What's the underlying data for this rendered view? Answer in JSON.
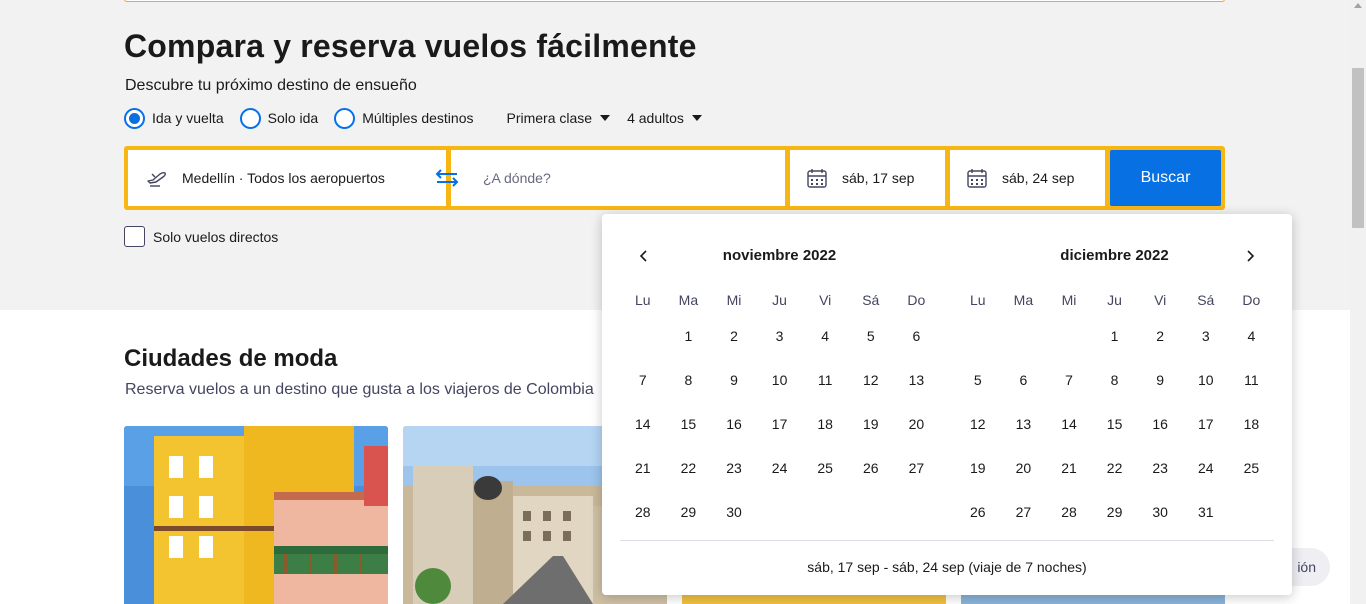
{
  "header": {
    "title": "Compara y reserva vuelos fácilmente",
    "subtitle": "Descubre tu próximo destino de ensueño"
  },
  "trip_options": {
    "round_trip": "Ida y vuelta",
    "one_way": "Solo ida",
    "multi_city": "Múltiples destinos",
    "selected": "Ida y vuelta",
    "cabin_class": "Primera clase",
    "travellers": "4 adultos"
  },
  "search": {
    "origin": "Medellín · Todos los aeropuertos",
    "destination_placeholder": "¿A dónde?",
    "depart_date": "sáb, 17 sep",
    "return_date": "sáb, 24 sep",
    "search_button": "Buscar"
  },
  "direct_only": {
    "label": "Solo vuelos directos",
    "checked": false
  },
  "trending": {
    "title": "Ciudades de moda",
    "subtitle": "Reserva vuelos a un destino que gusta a los viajeros de Colombia"
  },
  "calendar": {
    "weekdays": [
      "Lu",
      "Ma",
      "Mi",
      "Ju",
      "Vi",
      "Sá",
      "Do"
    ],
    "months": [
      {
        "title": "noviembre 2022",
        "leading_blanks": 1,
        "days": 30
      },
      {
        "title": "diciembre 2022",
        "leading_blanks": 3,
        "days": 31
      }
    ],
    "summary": "sáb, 17 sep - sáb, 24 sep (viaje de 7 noches)"
  },
  "feedback": {
    "label": "ión"
  },
  "colors": {
    "accent_blue": "#0770e3",
    "search_border": "#f8b614",
    "hero_background": "#f2f2f2"
  }
}
